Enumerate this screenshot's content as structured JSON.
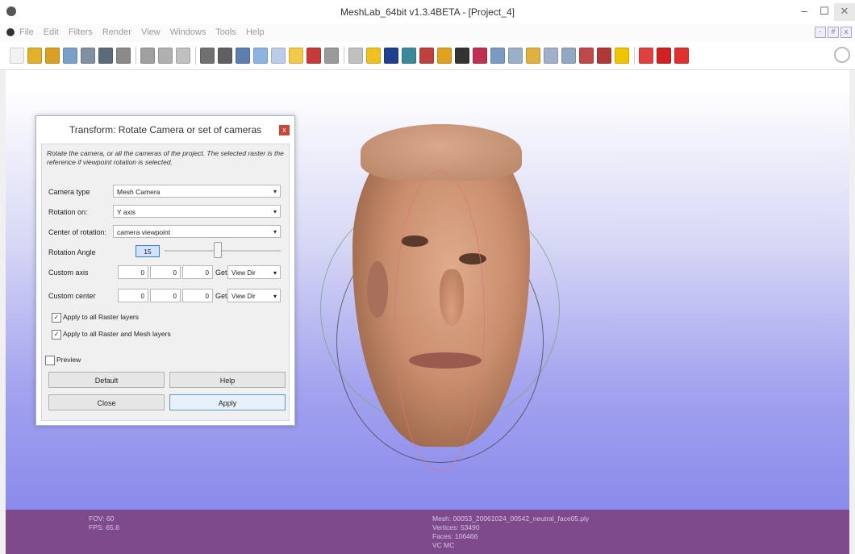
{
  "window": {
    "title": "MeshLab_64bit v1.3.4BETA - [Project_4]",
    "min_glyph": "–",
    "max_glyph": "☐",
    "close_glyph": "✕"
  },
  "menu": {
    "items": [
      "File",
      "Edit",
      "Filters",
      "Render",
      "View",
      "Windows",
      "Tools",
      "Help"
    ],
    "mdi_minimize": "-",
    "mdi_restore": "#",
    "mdi_close": "x"
  },
  "toolbar": {
    "buttons": [
      {
        "name": "new-project",
        "color": "#f2f2f2"
      },
      {
        "name": "open-project",
        "color": "#e1b12c"
      },
      {
        "name": "import-mesh",
        "color": "#d9a024"
      },
      {
        "name": "reload",
        "color": "#7aa0c8"
      },
      {
        "name": "reload-all",
        "color": "#8090a0"
      },
      {
        "name": "export-mesh",
        "color": "#5a6b7a"
      },
      {
        "name": "save-snapshot",
        "color": "#8a8a8a"
      },
      {
        "name": "layers",
        "color": "#a0a0a0"
      },
      {
        "name": "bounding-box",
        "color": "#b0b0b0"
      },
      {
        "name": "points",
        "color": "#c0c0c0"
      },
      {
        "name": "wireframe",
        "color": "#707070"
      },
      {
        "name": "hidden-lines",
        "color": "#606060"
      },
      {
        "name": "flat-lines",
        "color": "#5c7fb0"
      },
      {
        "name": "flat",
        "color": "#8fb3df"
      },
      {
        "name": "smooth",
        "color": "#b9cde8"
      },
      {
        "name": "light",
        "color": "#f3c94a"
      },
      {
        "name": "color-mode",
        "color": "#c83a3a"
      },
      {
        "name": "texture",
        "color": "#9a9a9a"
      },
      {
        "name": "trackball",
        "color": "#c0c0c0"
      },
      {
        "name": "annotation",
        "color": "#f0c020"
      },
      {
        "name": "select-faces",
        "color": "#1f3f8f"
      },
      {
        "name": "paint",
        "color": "#3a8a9a"
      },
      {
        "name": "measure",
        "color": "#c04040"
      },
      {
        "name": "pick-points",
        "color": "#e0a020"
      },
      {
        "name": "sketch",
        "color": "#333333"
      },
      {
        "name": "raster-align",
        "color": "#c03050"
      },
      {
        "name": "mutual-info",
        "color": "#7a9ac0"
      },
      {
        "name": "align",
        "color": "#9ab0c8"
      },
      {
        "name": "vertex-color",
        "color": "#e0b040"
      },
      {
        "name": "manipulator",
        "color": "#a0b0c8"
      },
      {
        "name": "select-connected",
        "color": "#90a8c0"
      },
      {
        "name": "rotate-camera",
        "color": "#c04848"
      },
      {
        "name": "z-painting",
        "color": "#b03838"
      },
      {
        "name": "info",
        "color": "#f2c400"
      },
      {
        "name": "delete-selected",
        "color": "#e04040"
      },
      {
        "name": "delete-vertices",
        "color": "#d02020"
      },
      {
        "name": "delete-faces",
        "color": "#e03030"
      }
    ]
  },
  "dialog": {
    "title": "Transform: Rotate Camera or set of cameras",
    "close_glyph": "x",
    "description": "Rotate the camera, or all the cameras of the project. The selected raster is the reference if viewpoint rotation is selected.",
    "camera_type": {
      "label": "Camera type",
      "value": "Mesh Camera"
    },
    "rotation_on": {
      "label": "Rotation on:",
      "value": "Y axis"
    },
    "center_of_rotation": {
      "label": "Center of rotation:",
      "value": "camera viewpoint"
    },
    "rotation_angle": {
      "label": "Rotation Angle",
      "value": "15"
    },
    "custom_axis": {
      "label": "Custom axis",
      "values": [
        "0",
        "0",
        "0"
      ],
      "get_label": "Get",
      "dir": "View Dir"
    },
    "custom_center": {
      "label": "Custom center",
      "values": [
        "0",
        "0",
        "0"
      ],
      "get_label": "Get",
      "dir": "View Dir"
    },
    "apply_raster": {
      "label": "Apply to all Raster layers",
      "checked": true
    },
    "apply_raster_mesh": {
      "label": "Apply to all Raster and Mesh layers",
      "checked": true
    },
    "preview": {
      "label": "Preview",
      "checked": false
    },
    "buttons": {
      "default": "Default",
      "help": "Help",
      "close": "Close",
      "apply": "Apply"
    },
    "dropdown_arrow": "▾",
    "check_glyph": "✓"
  },
  "statusbar": {
    "fov": "FOV: 60",
    "fps": "FPS:  65.8",
    "mesh": "Mesh: 00053_20061024_00542_neutral_face05.ply",
    "vertices": "Vertices: 53490",
    "faces": "Faces: 106466",
    "vc": "VC MC"
  },
  "colors": {
    "statusbar": "#7e4a8c",
    "viewport_bottom": "#8a8aec"
  }
}
